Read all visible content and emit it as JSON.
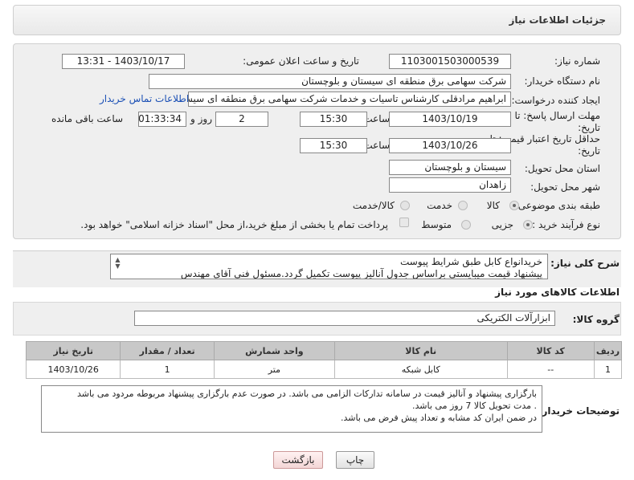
{
  "header": {
    "title": "جزئیات اطلاعات نیاز"
  },
  "form": {
    "need_number_label": "شماره نیاز:",
    "need_number": "1103001503000539",
    "announce_label": "تاریخ و ساعت اعلان عمومی:",
    "announce_value": "1403/10/17 - 13:31",
    "buyer_org_label": "نام دستگاه خریدار:",
    "buyer_org": "شرکت سهامی برق منطقه ای سیستان و بلوچستان",
    "creator_label": "ایجاد کننده درخواست:",
    "creator": "ابراهیم مرادقلی کارشناس تاسیات و خدمات شرکت سهامی برق منطقه ای سیستان و بلوچستان",
    "contact_link": "اطلاعات تماس خریدار",
    "reply_deadline_label": "مهلت ارسال پاسخ: تا",
    "reply_deadline_label2": "تاریخ:",
    "reply_date": "1403/10/19",
    "time_label": "ساعت",
    "reply_time": "15:30",
    "days_value": "2",
    "days_label": "روز و",
    "remaining_time": "01:33:34",
    "remaining_label": "ساعت باقی مانده",
    "price_validity_label": "حداقل تاریخ اعتبار قیمت: تا",
    "price_validity_label2": "تاریخ:",
    "validity_date": "1403/10/26",
    "validity_time": "15:30",
    "province_label": "استان محل تحویل:",
    "province": "سیستان و بلوچستان",
    "city_label": "شهر محل تحویل:",
    "city": "زاهدان",
    "category_label": "طبقه بندی موضوعی:",
    "category_options": [
      "کالا",
      "خدمت",
      "کالا/خدمت"
    ],
    "purchase_type_label": "نوع فرآیند خرید :",
    "purchase_options": [
      "جزیی",
      "متوسط"
    ],
    "treasury_note": "پرداخت تمام یا بخشی از مبلغ خرید،از محل \"اسناد خزانه اسلامی\" خواهد بود."
  },
  "description": {
    "label": "شرح کلی نیاز:",
    "line1": "خریدانواع کابل طبق شرایط پیوست",
    "line2": "پیشنهاد قیمت میبایستی براساس جدول آنالیز پیوست تکمیل گردد.مسئول فنی آقای مهندس"
  },
  "goods": {
    "section_title": "اطلاعات کالاهای مورد نیاز",
    "group_label": "گروه کالا:",
    "group_value": "ابزارآلات الکتریکی",
    "columns": [
      "ردیف",
      "کد کالا",
      "نام کالا",
      "واحد شمارش",
      "تعداد / مقدار",
      "تاریخ نیاز"
    ],
    "rows": [
      {
        "row": "1",
        "code": "--",
        "name": "کابل شبکه",
        "unit": "متر",
        "qty": "1",
        "date": "1403/10/26"
      }
    ]
  },
  "buyer_notes": {
    "label": "توضیحات خریدار:",
    "line1": "بارگزاری پیشنهاد و آنالیز قیمت در سامانه تدارکات الزامی می باشد. در صورت عدم بارگزاری پیشنهاد مربوطه مردود می باشد",
    "line2": ". مدت تحویل  کالا 7 روز می باشد.",
    "line3": "در ضمن ایران کد مشابه و تعداد پیش فرض می باشد."
  },
  "buttons": {
    "print": "چاپ",
    "back": "بازگشت"
  }
}
